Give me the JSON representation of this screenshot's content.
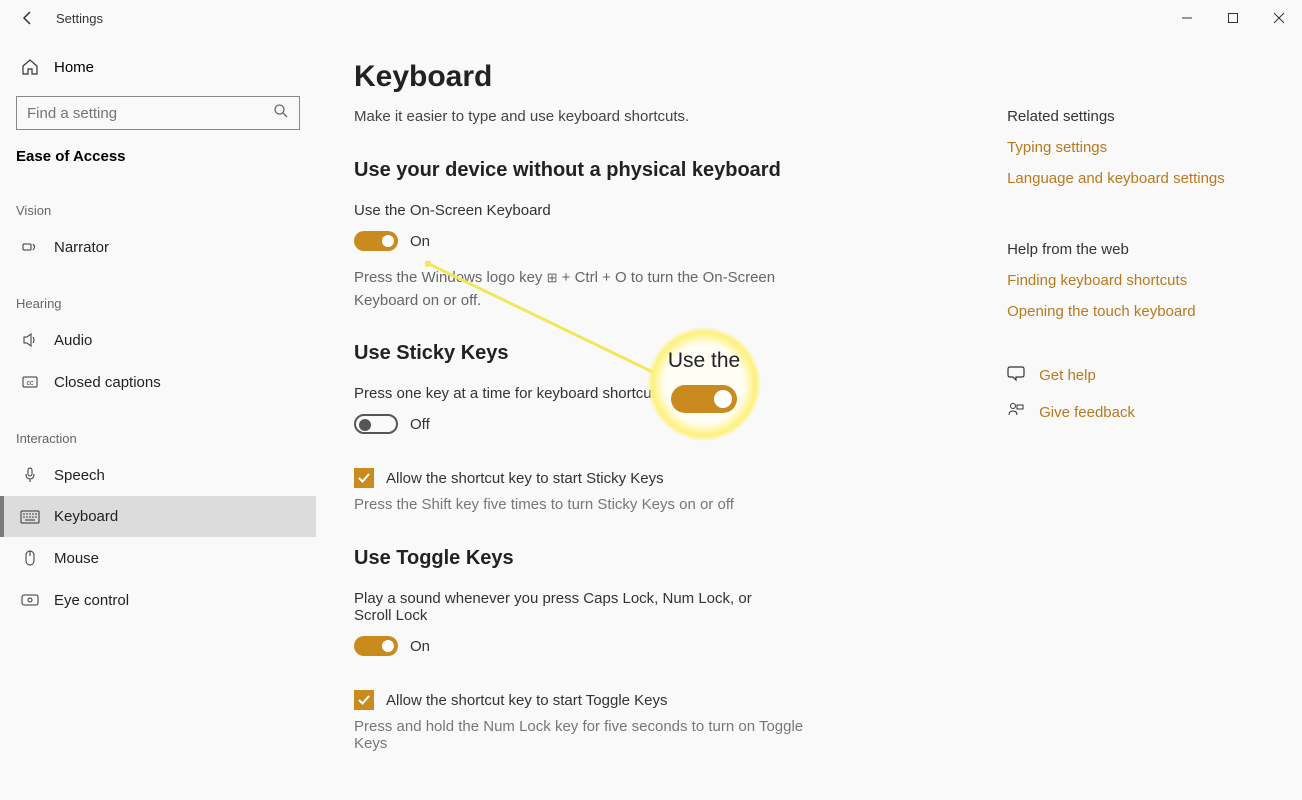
{
  "titlebar": {
    "app_title": "Settings"
  },
  "sidebar": {
    "home": "Home",
    "search_placeholder": "Find a setting",
    "ease_header": "Ease of Access",
    "categories": {
      "vision": {
        "header": "Vision",
        "items": [
          {
            "label": "Narrator"
          }
        ]
      },
      "hearing": {
        "header": "Hearing",
        "items": [
          {
            "label": "Audio"
          },
          {
            "label": "Closed captions"
          }
        ]
      },
      "interaction": {
        "header": "Interaction",
        "items": [
          {
            "label": "Speech"
          },
          {
            "label": "Keyboard"
          },
          {
            "label": "Mouse"
          },
          {
            "label": "Eye control"
          }
        ]
      }
    }
  },
  "content": {
    "title": "Keyboard",
    "subtitle": "Make it easier to type and use keyboard shortcuts.",
    "sections": {
      "osk": {
        "heading": "Use your device without a physical keyboard",
        "label": "Use the On-Screen Keyboard",
        "toggle_state": "On",
        "hint_pre": "Press the Windows logo key ",
        "hint_post": " + Ctrl + O to turn the On-Screen Keyboard on or off."
      },
      "sticky": {
        "heading": "Use Sticky Keys",
        "label": "Press one key at a time for keyboard shortcuts",
        "toggle_state": "Off",
        "checkbox_label": "Allow the shortcut key to start Sticky Keys",
        "checkbox_hint": "Press the Shift key five times to turn Sticky Keys on or off"
      },
      "toggle_keys": {
        "heading": "Use Toggle Keys",
        "label": "Play a sound whenever you press Caps Lock, Num Lock, or Scroll Lock",
        "toggle_state": "On",
        "checkbox_label": "Allow the shortcut key to start Toggle Keys",
        "checkbox_hint": "Press and hold the Num Lock key for five seconds to turn on Toggle Keys"
      }
    }
  },
  "side": {
    "related_header": "Related settings",
    "related_links": [
      "Typing settings",
      "Language and keyboard settings"
    ],
    "web_header": "Help from the web",
    "web_links": [
      "Finding keyboard shortcuts",
      "Opening the touch keyboard"
    ],
    "actions": {
      "help": "Get help",
      "feedback": "Give feedback"
    }
  },
  "callout": {
    "text": "Use the"
  }
}
